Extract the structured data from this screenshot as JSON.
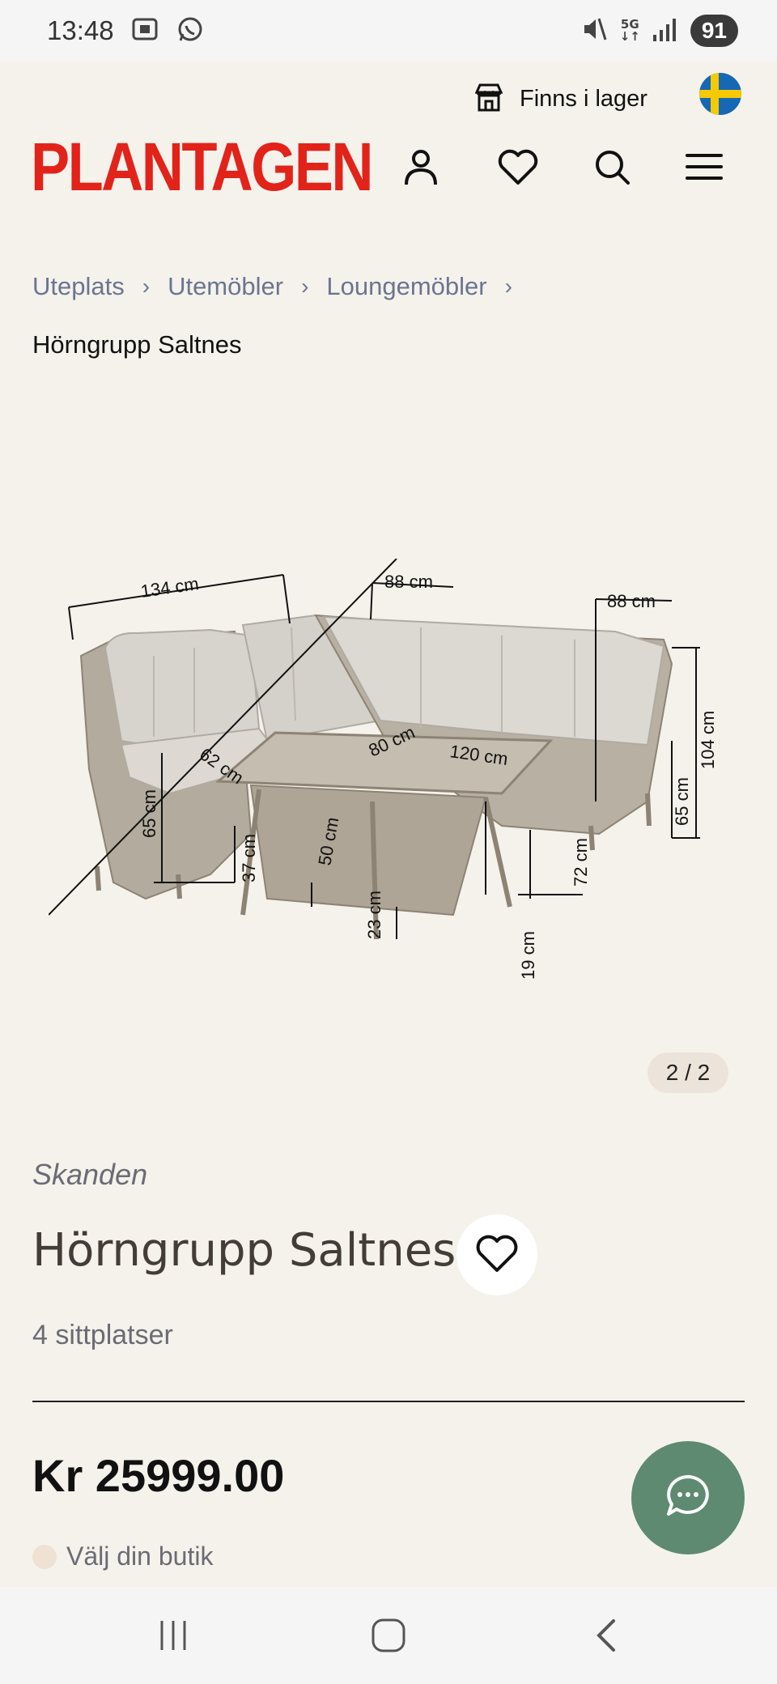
{
  "status_bar": {
    "time": "13:48",
    "network": "5G",
    "battery": "91"
  },
  "header": {
    "stock_label": "Finns i lager",
    "logo": "PLANTAGEN",
    "brand_color": "#e2231a"
  },
  "breadcrumb": {
    "items": [
      "Uteplats",
      "Utemöbler",
      "Loungemöbler"
    ],
    "current": "Hörngrupp Saltnes"
  },
  "product": {
    "image_counter": "2 / 2",
    "brand": "Skanden",
    "title": "Hörngrupp Saltnes",
    "seats": "4 sittplatser",
    "price": "Kr 25999.00",
    "store_prompt": "Välj din butik",
    "dimensions": [
      "134 cm",
      "88 cm",
      "88 cm",
      "104 cm",
      "62 cm",
      "80 cm",
      "120 cm",
      "65 cm",
      "37 cm",
      "50 cm",
      "23 cm",
      "19 cm",
      "72 cm",
      "65 cm"
    ]
  },
  "colors": {
    "background": "#f5f2ec",
    "chat_button": "#5e8a72",
    "counter_pill": "#ece3da"
  }
}
